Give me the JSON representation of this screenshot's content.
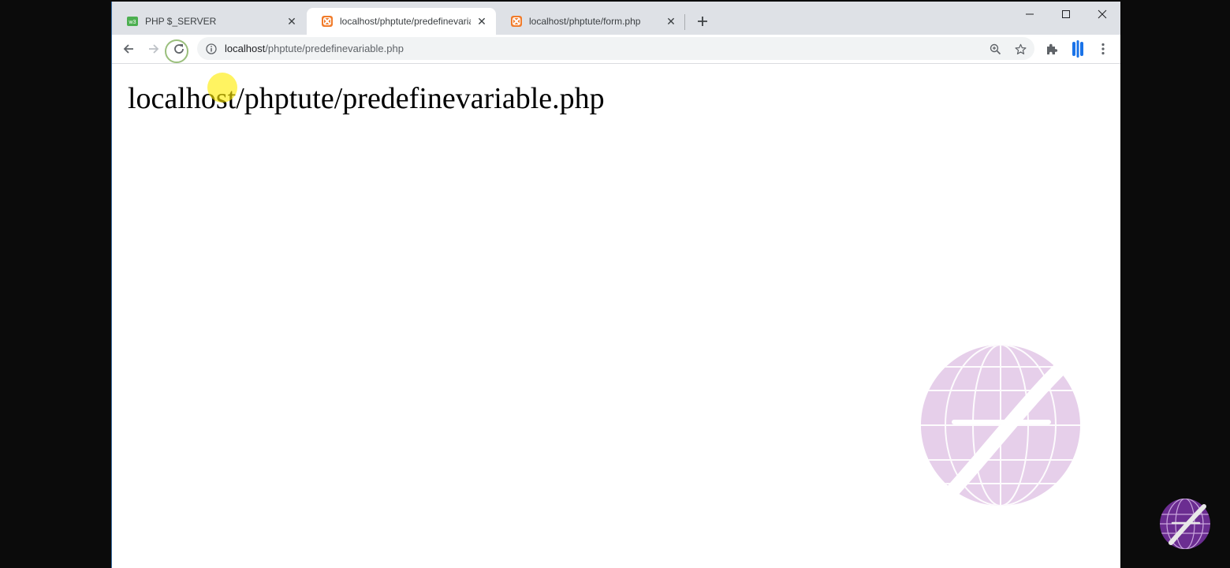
{
  "browser": {
    "tabs": [
      {
        "title": "PHP $_SERVER",
        "favicon": "w3schools-favicon-icon",
        "active": false
      },
      {
        "title": "localhost/phptute/predefinevariable.php",
        "favicon": "xampp-favicon-icon",
        "active": true
      },
      {
        "title": "localhost/phptute/form.php",
        "favicon": "xampp-favicon-icon",
        "active": false
      }
    ],
    "address_bar": {
      "host": "localhost",
      "path": "/phptute/predefinevariable.php"
    }
  },
  "page": {
    "heading": "localhost/phptute/predefinevariable.php"
  },
  "colors": {
    "w3schools_green": "#4caf50",
    "xampp_orange": "#f17b2a",
    "watermark_lavender": "#e6cfea",
    "logo_purple": "#6b2d91"
  }
}
